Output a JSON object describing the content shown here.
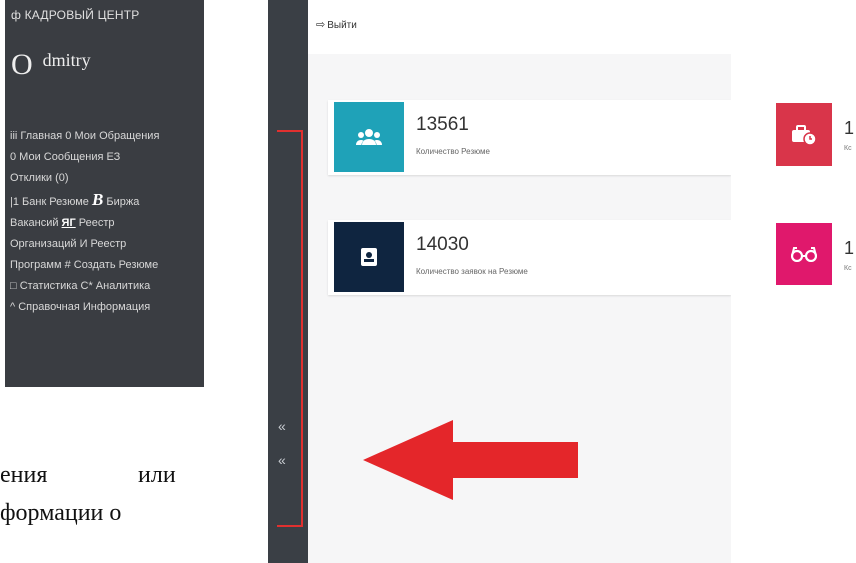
{
  "sidebar_panel": {
    "brand": "ф КАДРОВЫЙ ЦЕНТР",
    "avatar_glyph": "O",
    "username": "dmitry",
    "nav_lines": [
      {
        "parts": [
          "iii Главная 0 Мои Обращения"
        ]
      },
      {
        "parts": [
          "0 Мои Сообщения ЕЗ"
        ]
      },
      {
        "parts": [
          "Отклики (0)"
        ]
      },
      {
        "parts": [
          "|1 Банк Резюме ",
          "B",
          " Биржа"
        ]
      },
      {
        "parts": [
          "Вакансий ",
          "ЯГ",
          " Реестр"
        ]
      },
      {
        "parts": [
          "Организаций И Реестр"
        ]
      },
      {
        "parts": [
          "Программ # Создать Резюме"
        ]
      },
      {
        "parts": [
          "□ Статистика С* Аналитика"
        ]
      },
      {
        "parts": [
          "^ Справочная Информация"
        ]
      }
    ]
  },
  "document_text": {
    "line1_a": "ения",
    "line1_b": "или",
    "line2": "формации о"
  },
  "screenshot": {
    "logout_icon": "logout-icon",
    "logout_label": "Выйти",
    "collapse_chevrons": [
      "«",
      "«"
    ],
    "cards": [
      {
        "value": "13561",
        "label": "Количество Резюме",
        "icon": "users-icon",
        "color": "#1fa2b8"
      },
      {
        "value": "14030",
        "label": "Количество заявок на Резюме",
        "icon": "id-card-icon",
        "color": "#0f2540"
      }
    ],
    "right_cards": [
      {
        "value": "1",
        "label": "Кс",
        "icon": "briefcase-clock-icon",
        "color": "#d9354a"
      },
      {
        "value": "1",
        "label": "Кс",
        "icon": "glasses-icon",
        "color": "#e0186c"
      }
    ],
    "accent_colors": {
      "highlight_red": "#e0302f",
      "sidebar_dark": "#3a3f45"
    }
  }
}
